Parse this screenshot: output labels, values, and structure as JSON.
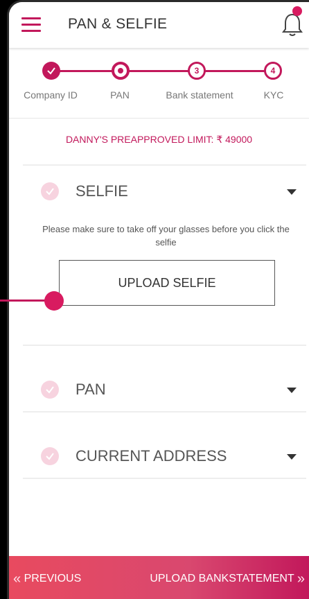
{
  "header": {
    "title": "PAN & SELFIE"
  },
  "stepper": {
    "steps": [
      {
        "label": "Company ID",
        "state": "done"
      },
      {
        "label": "PAN",
        "state": "current"
      },
      {
        "label": "Bank statement",
        "state": "pending",
        "number": "3"
      },
      {
        "label": "KYC",
        "state": "pending",
        "number": "4"
      }
    ]
  },
  "limit_text": "DANNY'S PREAPPROVED LIMIT: ₹ 49000",
  "sections": {
    "selfie": {
      "label": "SELFIE",
      "note": "Please make sure to take off your glasses before you click the selfie",
      "upload_label": "UPLOAD SELFIE"
    },
    "pan": {
      "label": "PAN"
    },
    "address": {
      "label": "CURRENT ADDRESS"
    }
  },
  "footer": {
    "previous_label": "PREVIOUS",
    "next_label": "UPLOAD BANKSTATEMENT"
  },
  "colors": {
    "accent": "#c2185b",
    "check_bg": "#f7d3df",
    "footer_start": "#e84a5f"
  },
  "icons": [
    "menu-icon",
    "bell-icon",
    "check-icon",
    "caret-down-icon",
    "chevron-left-icon",
    "chevron-right-icon"
  ]
}
